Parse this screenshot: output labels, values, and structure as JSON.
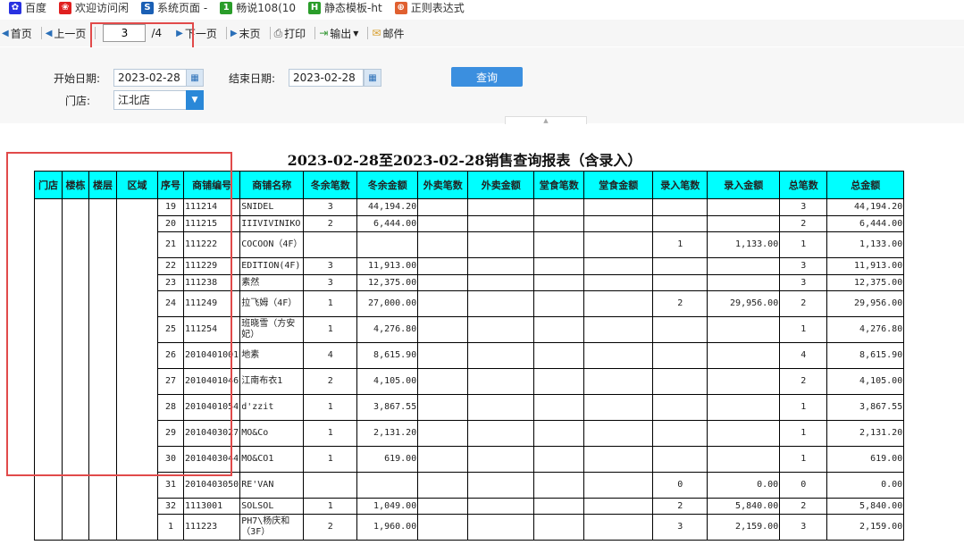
{
  "bookmarks": [
    {
      "label": "百度",
      "icon": "paw-icon",
      "color": "#2932e1"
    },
    {
      "label": "欢迎访问闲",
      "icon": "brand-icon",
      "color": "#e02020"
    },
    {
      "label": "系统页面 -",
      "icon": "s-icon",
      "color": "#1a5fb4"
    },
    {
      "label": "畅说108(10",
      "icon": "108-icon",
      "color": "#2a9d2a"
    },
    {
      "label": "静态模板-ht",
      "icon": "h5-icon",
      "color": "#2a9d2a"
    },
    {
      "label": "正则表达式",
      "icon": "regex-icon",
      "color": "#e06030"
    }
  ],
  "toolbar": {
    "first": "首页",
    "prev": "上一页",
    "page_current": "3",
    "page_total": "/4",
    "next": "下一页",
    "last": "末页",
    "print": "打印",
    "export": "输出",
    "mail": "邮件"
  },
  "search": {
    "start_label": "开始日期:",
    "start_value": "2023-02-28",
    "end_label": "结束日期:",
    "end_value": "2023-02-28",
    "store_label": "门店:",
    "store_value": "江北店",
    "query_label": "查询"
  },
  "report": {
    "title": "2023-02-28至2023-02-28销售查询报表（含录入）",
    "headers": [
      "门店",
      "楼栋",
      "楼层",
      "区域",
      "序号",
      "商铺编号",
      "商铺名称",
      "冬余笔数",
      "冬余金额",
      "外卖笔数",
      "外卖金额",
      "堂食笔数",
      "堂食金额",
      "录入笔数",
      "录入金额",
      "总笔数",
      "总金额"
    ],
    "rows": [
      [
        "19",
        "111214",
        "SNIDEL",
        "3",
        "44,194.20",
        "",
        "",
        "",
        "",
        "",
        "",
        "3",
        "44,194.20"
      ],
      [
        "20",
        "111215",
        "IIIVIVINIKO",
        "2",
        "6,444.00",
        "",
        "",
        "",
        "",
        "",
        "",
        "2",
        "6,444.00"
      ],
      [
        "21",
        "111222",
        "COCOON（4F）",
        "",
        "",
        "",
        "",
        "",
        "",
        "1",
        "1,133.00",
        "1",
        "1,133.00"
      ],
      [
        "22",
        "111229",
        "EDITION(4F)",
        "3",
        "11,913.00",
        "",
        "",
        "",
        "",
        "",
        "",
        "3",
        "11,913.00"
      ],
      [
        "23",
        "111238",
        "素然",
        "3",
        "12,375.00",
        "",
        "",
        "",
        "",
        "",
        "",
        "3",
        "12,375.00"
      ],
      [
        "24",
        "111249",
        "拉飞姆（4F）",
        "1",
        "27,000.00",
        "",
        "",
        "",
        "",
        "2",
        "29,956.00",
        "2",
        "29,956.00"
      ],
      [
        "25",
        "111254",
        "班晓雪（方安妃）",
        "1",
        "4,276.80",
        "",
        "",
        "",
        "",
        "",
        "",
        "1",
        "4,276.80"
      ],
      [
        "26",
        "2010401001",
        "地素",
        "4",
        "8,615.90",
        "",
        "",
        "",
        "",
        "",
        "",
        "4",
        "8,615.90"
      ],
      [
        "27",
        "2010401046",
        "江南布衣1",
        "2",
        "4,105.00",
        "",
        "",
        "",
        "",
        "",
        "",
        "2",
        "4,105.00"
      ],
      [
        "28",
        "2010401054",
        "d'zzit",
        "1",
        "3,867.55",
        "",
        "",
        "",
        "",
        "",
        "",
        "1",
        "3,867.55"
      ],
      [
        "29",
        "2010403027",
        "MO&Co",
        "1",
        "2,131.20",
        "",
        "",
        "",
        "",
        "",
        "",
        "1",
        "2,131.20"
      ],
      [
        "30",
        "2010403044",
        "MO&CO1",
        "1",
        "619.00",
        "",
        "",
        "",
        "",
        "",
        "",
        "1",
        "619.00"
      ],
      [
        "31",
        "2010403050",
        "RE'VAN",
        "",
        "",
        "",
        "",
        "",
        "",
        "0",
        "0.00",
        "0",
        "0.00"
      ],
      [
        "32",
        "1113001",
        "SOLSOL",
        "1",
        "1,049.00",
        "",
        "",
        "",
        "",
        "2",
        "5,840.00",
        "2",
        "5,840.00"
      ],
      [
        "1",
        "111223",
        "PH7\\杨庆和（3F）",
        "2",
        "1,960.00",
        "",
        "",
        "",
        "",
        "3",
        "2,159.00",
        "3",
        "2,159.00"
      ]
    ]
  }
}
